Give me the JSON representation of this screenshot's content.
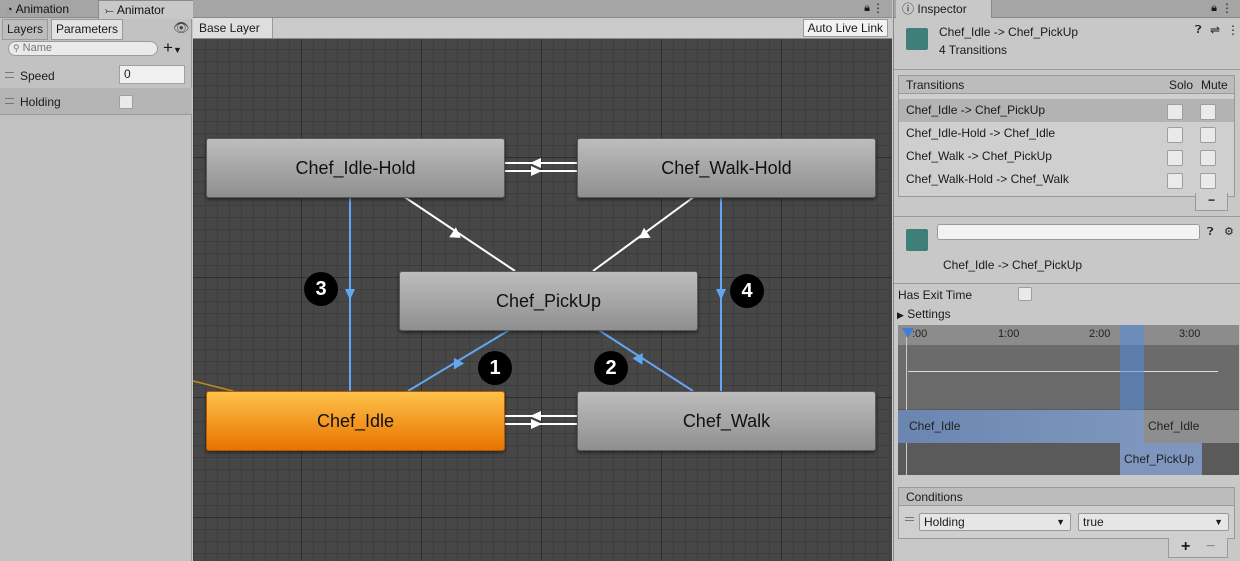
{
  "window_tabs": {
    "animation": "Animation",
    "animator": "Animator",
    "inspector": "Inspector"
  },
  "left_panel": {
    "tabs": [
      "Layers",
      "Parameters"
    ],
    "add_button": "+",
    "search_placeholder": "Name",
    "parameters": [
      {
        "name": "Speed",
        "value": "0",
        "type": "float"
      },
      {
        "name": "Holding",
        "value": false,
        "type": "bool"
      }
    ]
  },
  "graph": {
    "breadcrumb": "Base Layer",
    "auto_live_link": "Auto Live Link",
    "states": [
      {
        "name": "Chef_Idle-Hold"
      },
      {
        "name": "Chef_Walk-Hold"
      },
      {
        "name": "Chef_PickUp"
      },
      {
        "name": "Chef_Idle",
        "is_default": true
      },
      {
        "name": "Chef_Walk"
      }
    ],
    "markers": [
      "1",
      "2",
      "3",
      "4"
    ]
  },
  "inspector": {
    "title": "Chef_Idle -> Chef_PickUp",
    "subtitle": "4 Transitions",
    "transitions_header": {
      "label": "Transitions",
      "solo": "Solo",
      "mute": "Mute"
    },
    "transitions": [
      {
        "label": "Chef_Idle -> Chef_PickUp",
        "selected": true
      },
      {
        "label": "Chef_Idle-Hold -> Chef_Idle"
      },
      {
        "label": "Chef_Walk -> Chef_PickUp"
      },
      {
        "label": "Chef_Walk-Hold -> Chef_Walk"
      }
    ],
    "remove_button": "−",
    "transition_name": "Chef_Idle -> Chef_PickUp",
    "has_exit_time_label": "Has Exit Time",
    "has_exit_time": false,
    "settings_label": "Settings",
    "timeline": {
      "ticks": [
        ":00",
        "1:00",
        "2:00",
        "3:00"
      ],
      "source_clip": "Chef_Idle",
      "source_clip_repeat": "Chef_Idle",
      "dest_clip": "Chef_PickUp"
    },
    "conditions": {
      "label": "Conditions",
      "parameter": "Holding",
      "value": "true",
      "add": "+",
      "remove": "−"
    }
  },
  "colors": {
    "default_state": "#f08a00",
    "selected_transition": "#63a6f2",
    "grid_bg": "#474747"
  }
}
